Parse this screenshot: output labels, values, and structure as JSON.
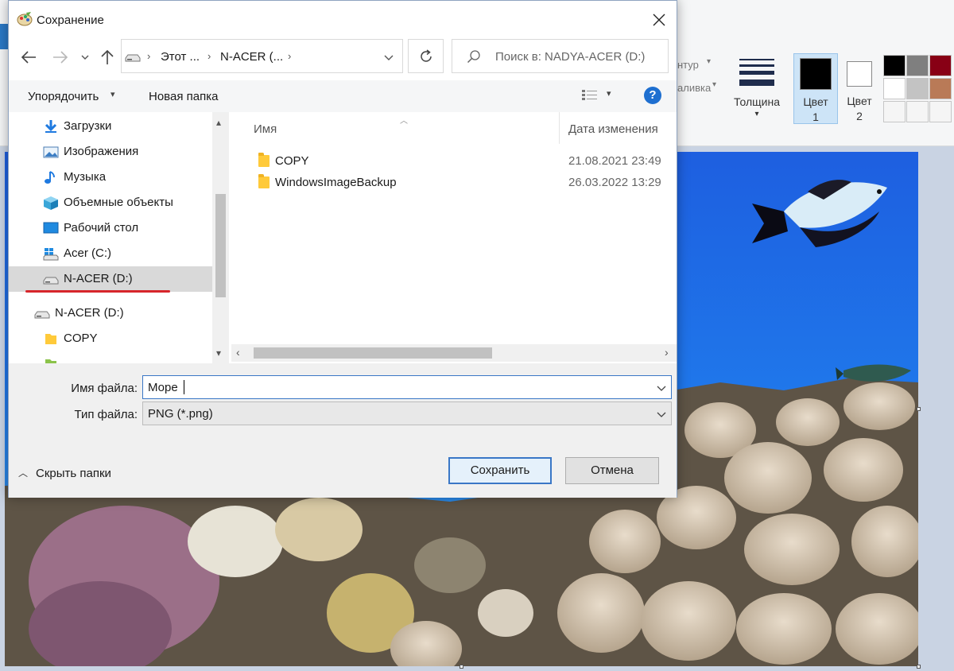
{
  "paint": {
    "ribbon": {
      "outline_label": "нтур",
      "fill_label": "аливка",
      "thickness_label": "Толщина",
      "color1_label_line1": "Цвет",
      "color1_label_line2": "1",
      "color2_label_line1": "Цвет",
      "color2_label_line2": "2",
      "palette": [
        "#000000",
        "#7f7f7f",
        "#880015",
        "#ffffff",
        "#c3c3c3",
        "#b97a57",
        "#f5f5f5",
        "#f5f5f5",
        "#f5f5f5"
      ]
    },
    "color1_value": "#000000",
    "color2_value": "#ffffff"
  },
  "dialog": {
    "title": "Сохранение",
    "address": {
      "crumb1": "Этот ...",
      "crumb2": "N-ACER (..."
    },
    "search_placeholder": "Поиск в: NADYA-ACER (D:)",
    "toolbar": {
      "organize_label": "Упорядочить",
      "new_folder_label": "Новая папка"
    },
    "nav_items": [
      {
        "label": "Загрузки",
        "icon": "downloads-icon"
      },
      {
        "label": "Изображения",
        "icon": "pictures-icon"
      },
      {
        "label": "Музыка",
        "icon": "music-icon"
      },
      {
        "label": "Объемные объекты",
        "icon": "3d-objects-icon"
      },
      {
        "label": "Рабочий стол",
        "icon": "desktop-icon"
      },
      {
        "label": "Acer (C:)",
        "icon": "windows-drive-icon"
      },
      {
        "label": "N-ACER (D:)",
        "icon": "drive-icon"
      },
      {
        "label": "N-ACER (D:)",
        "icon": "drive-icon"
      },
      {
        "label": "COPY",
        "icon": "folder-icon"
      }
    ],
    "columns": {
      "name": "Имя",
      "date": "Дата изменения"
    },
    "files": [
      {
        "name": "COPY",
        "date": "21.08.2021 23:49"
      },
      {
        "name": "WindowsImageBackup",
        "date": "26.03.2022 13:29"
      }
    ],
    "filename_label": "Имя файла:",
    "filename_value": "Море",
    "filetype_label": "Тип файла:",
    "filetype_value": "PNG (*.png)",
    "hide_folders_label": "Скрыть папки",
    "save_label": "Сохранить",
    "cancel_label": "Отмена"
  }
}
